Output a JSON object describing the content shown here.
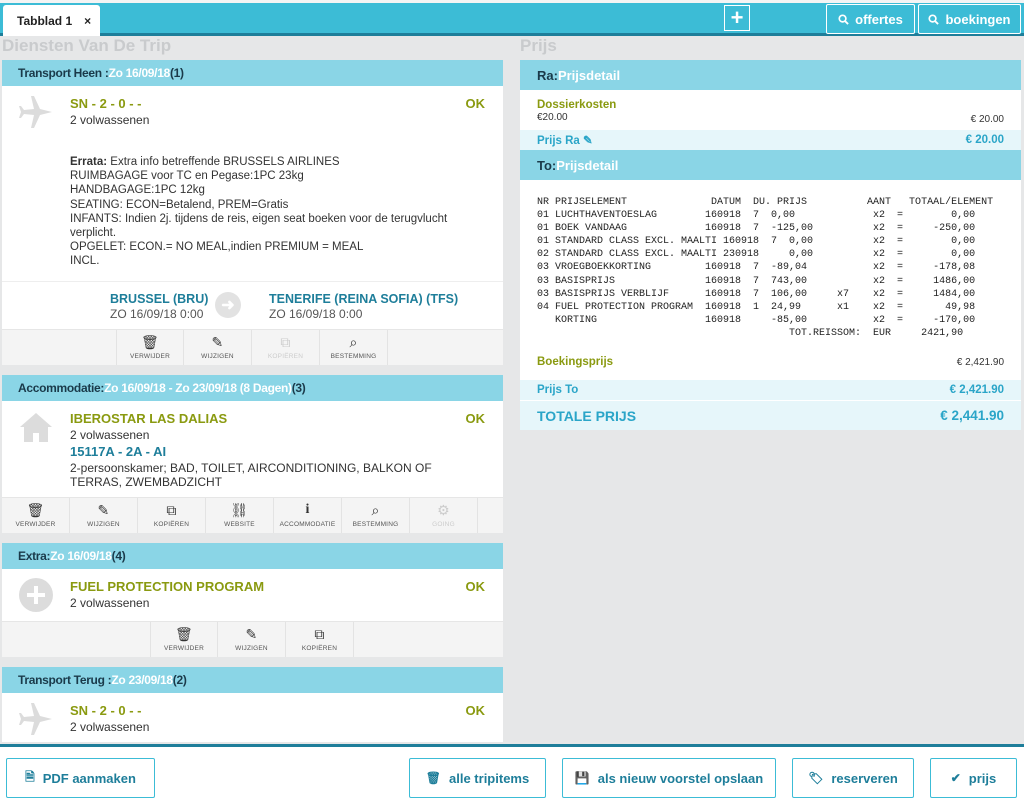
{
  "topbar": {
    "tab_label": "Tabblad 1",
    "tab_close": "×",
    "add_symbol": "+",
    "offertes_label": "offertes",
    "boekingen_label": "boekingen",
    "search_icon": "search-icon"
  },
  "left": {
    "section_title": "Diensten Van De Trip",
    "cards": [
      {
        "header_label": "Transport Heen : ",
        "header_date": "Zo 16/09/18",
        "header_count": " (1)",
        "icon": "plane-icon",
        "title": "SN - 2 - 0 - -",
        "subtitle": "2 volwassenen",
        "status": "OK",
        "errata_label": "Errata:",
        "errata_first": " Extra info betreffende BRUSSELS AIRLINES",
        "errata_lines": [
          "RUIMBAGAGE voor TC en Pegase:1PC 23kg",
          "HANDBAGAGE:1PC 12kg",
          "SEATING: ECON=Betalend, PREM=Gratis",
          "INFANTS: Indien 2j. tijdens de reis, eigen seat boeken voor de terugvlucht verplicht.",
          "OPGELET: ECON.= NO MEAL,indien PREMIUM = MEAL",
          "INCL."
        ],
        "from_city": "BRUSSEL (BRU)",
        "from_date": "ZO 16/09/18 0:00",
        "to_city": "TENERIFE (REINA SOFIA) (TFS)",
        "to_date": "ZO 16/09/18 0:00",
        "actions": [
          "VERWIJDER",
          "WIJZIGEN",
          "KOPIËREN",
          "BESTEMMING"
        ]
      },
      {
        "header_label": "Accommodatie: ",
        "header_date": "Zo 16/09/18 - Zo 23/09/18 (8 Dagen)",
        "header_count": " (3)",
        "icon": "house-icon",
        "title": "IBEROSTAR LAS DALIAS",
        "subtitle": "2 volwassenen",
        "code": "15117A - 2A - AI",
        "room": "2-persoonskamer; BAD, TOILET, AIRCONDITIONING, BALKON OF TERRAS, ZWEMBADZICHT",
        "status": "OK",
        "actions": [
          "VERWIJDER",
          "WIJZIGEN",
          "KOPIËREN",
          "WEBSITE",
          "ACCOMMODATIE",
          "BESTEMMING",
          "GOING"
        ]
      },
      {
        "header_label": "Extra: ",
        "header_date": "Zo 16/09/18",
        "header_count": " (4)",
        "icon": "plus-circle-icon",
        "title": "FUEL PROTECTION PROGRAM",
        "subtitle": "2 volwassenen",
        "status": "OK",
        "actions": [
          "VERWIJDER",
          "WIJZIGEN",
          "KOPIËREN"
        ]
      },
      {
        "header_label": "Transport Terug : ",
        "header_date": "Zo 23/09/18",
        "header_count": " (2)",
        "icon": "plane-icon",
        "title": "SN - 2 - 0 - -",
        "subtitle": "2 volwassenen",
        "status": "OK"
      }
    ]
  },
  "right": {
    "section_title": "Prijs",
    "ra_label": "Ra: ",
    "ra_detail": "Prijsdetail",
    "dossier_label": "Dossierkosten",
    "dossier_value": "€20.00",
    "dossier_total": "€ 20.00",
    "prijs_ra_label": "Prijs Ra",
    "prijs_ra_value": "€ 20.00",
    "to_label": "To: ",
    "to_detail": "Prijsdetail",
    "price_table": "NR PRIJSELEMENT              DATUM  DU. PRIJS          AANT   TOTAAL/ELEMENT\n01 LUCHTHAVENTOESLAG        160918  7  0,00             x2  =        0,00\n01 BOEK VANDAAG             160918  7  -125,00          x2  =     -250,00\n01 STANDARD CLASS EXCL. MAALTI 160918  7  0,00          x2  =        0,00\n02 STANDARD CLASS EXCL. MAALTI 230918     0,00          x2  =        0,00\n03 VROEGBOEKKORTING         160918  7  -89,04           x2  =     -178,08\n03 BASISPRIJS               160918  7  743,00           x2  =     1486,00\n03 BASISPRIJS VERBLIJF      160918  7  106,00     x7    x2  =     1484,00\n04 FUEL PROTECTION PROGRAM  160918  1  24,99      x1    x2  =       49,98\n   KORTING                  160918     -85,00           x2  =     -170,00\n                                          TOT.REISSOM:  EUR     2421,90",
    "boekingsprijs_label": "Boekingsprijs",
    "boekingsprijs_value": "€ 2,421.90",
    "prijs_to_label": "Prijs To",
    "prijs_to_value": "€ 2,421.90",
    "totale_label": "TOTALE PRIJS",
    "totale_value": "€ 2,441.90"
  },
  "bottombar": {
    "pdf_label": "PDF aanmaken",
    "alle_label": "alle tripitems",
    "opslaan_label": "als nieuw voorstel opslaan",
    "reserveren_label": "reserveren",
    "prijs_label": "prijs"
  },
  "colors": {
    "accent": "#3cbcd6",
    "header_light": "#8ad5e6",
    "dark_blue": "#1e7e9a",
    "olive": "#8a9a10"
  }
}
